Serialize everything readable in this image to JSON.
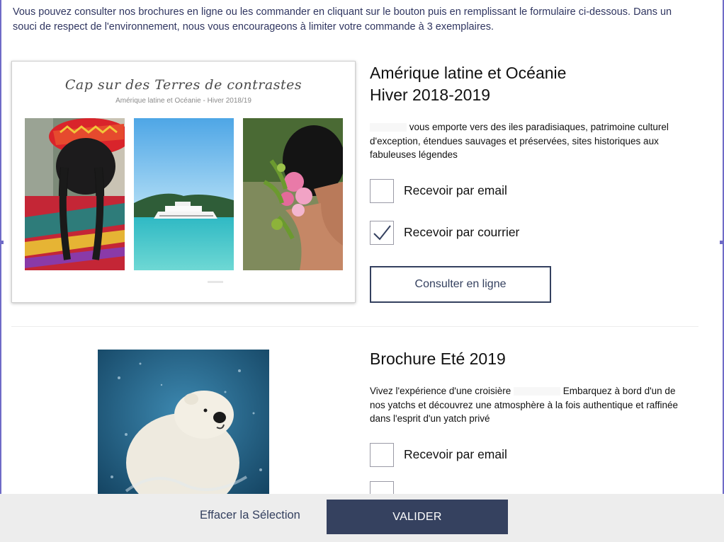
{
  "intro_text": "Vous pouvez consulter nos brochures en ligne ou les commander en cliquant sur le bouton puis en remplissant le formulaire ci-dessous. Dans un souci de respect de l'environnement, nous vous encourageons à limiter votre commande à 3 exemplaires.",
  "brochures": [
    {
      "cover_title": "Cap sur des Terres de contrastes",
      "cover_subtitle": "Amérique latine et Océanie - Hiver 2018/19",
      "title_line1": "Amérique latine et Océanie",
      "title_line2": "Hiver 2018-2019",
      "desc_after_redaction": " vous emporte vers des iles paradisiaques, patrimoine culturel d'exception, étendues sauvages et préservées, sites historiques aux fabuleuses légendes",
      "options": [
        {
          "label": "Recevoir par email",
          "checked": false
        },
        {
          "label": "Recevoir par courrier",
          "checked": true
        }
      ],
      "button_label": "Consulter en ligne"
    },
    {
      "title_line1": "Brochure Eté 2019",
      "desc_before_redaction": "Vivez l'expérience d'une croisière ",
      "desc_after_redaction": " Embarquez à bord d'un de nos yatchs et découvrez une atmosphère à la fois authentique et raffinée dans l'esprit d'un yatch privé",
      "options": [
        {
          "label": "Recevoir par email",
          "checked": false
        }
      ]
    }
  ],
  "footer": {
    "clear_label": "Effacer la Sélection",
    "submit_label": "VALIDER"
  },
  "colors": {
    "accent_navy": "#35415f",
    "frame_purple": "#6f6bc7",
    "footer_bg": "#ededed"
  }
}
